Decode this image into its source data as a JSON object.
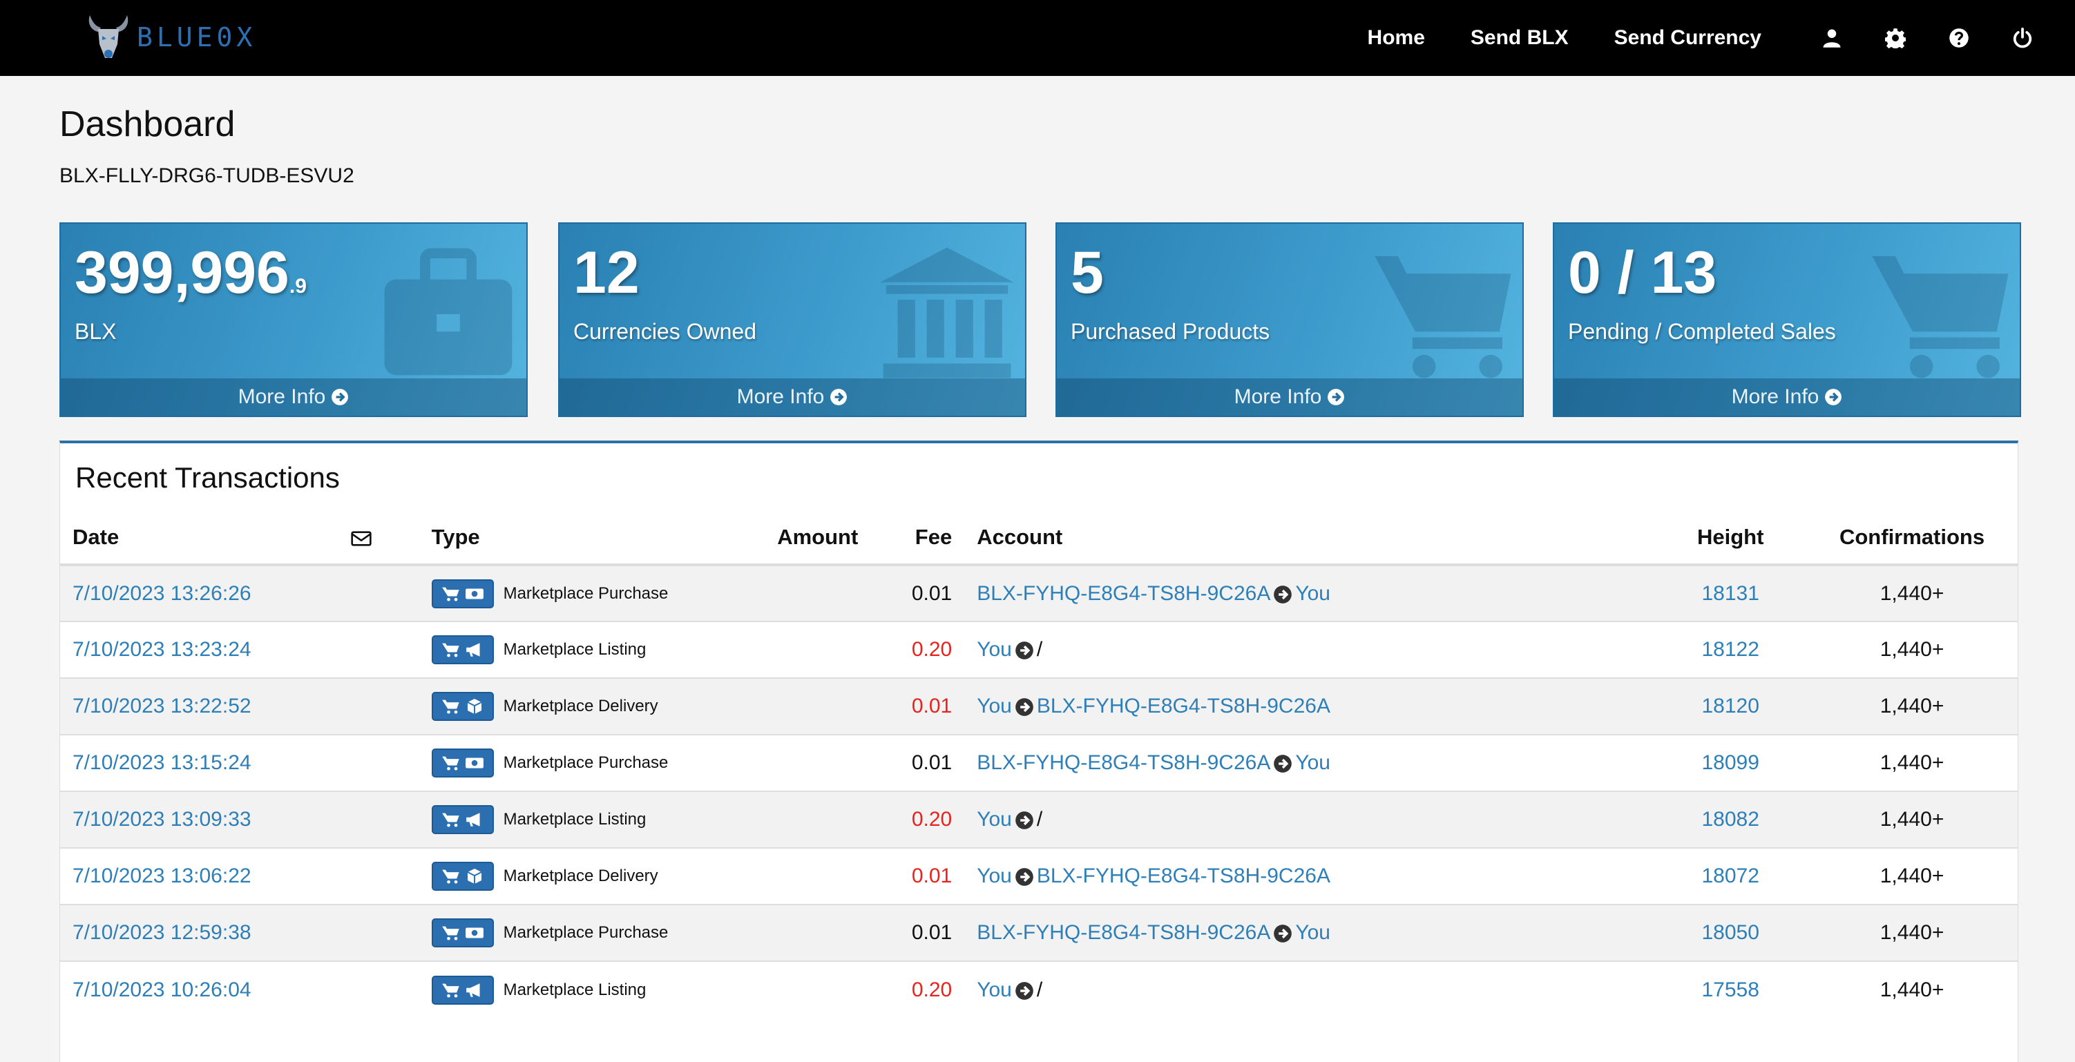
{
  "brand": {
    "name": "BLUE0X"
  },
  "nav": {
    "links": [
      "Home",
      "Send BLX",
      "Send Currency"
    ],
    "icons": [
      "user-icon",
      "gear-icon",
      "question-icon",
      "power-icon"
    ]
  },
  "page": {
    "title": "Dashboard",
    "account": "BLX-FLLY-DRG6-TUDB-ESVU2"
  },
  "info_boxes": [
    {
      "value": "399,996",
      "decimal": ".9",
      "label": "BLX",
      "footer": "More Info",
      "icon": "briefcase-icon"
    },
    {
      "value": "12",
      "decimal": "",
      "label": "Currencies Owned",
      "footer": "More Info",
      "icon": "bank-icon"
    },
    {
      "value": "5",
      "decimal": "",
      "label": "Purchased Products",
      "footer": "More Info",
      "icon": "cart-icon"
    },
    {
      "value": "0 / 13",
      "decimal": "",
      "label": "Pending / Completed Sales",
      "footer": "More Info",
      "icon": "cart-icon"
    }
  ],
  "transactions": {
    "title": "Recent Transactions",
    "columns": [
      "Date",
      "",
      "Type",
      "Amount",
      "Fee",
      "Account",
      "Height",
      "Confirmations"
    ],
    "rows": [
      {
        "date": "7/10/2023 13:26:26",
        "type": "Marketplace Purchase",
        "kind": "purchase",
        "amount": "",
        "fee": "0.01",
        "fee_color": "black",
        "from": "BLX-FYHQ-E8G4-TS8H-9C26A",
        "to": "You",
        "height": "18131",
        "confirmations": "1,440+"
      },
      {
        "date": "7/10/2023 13:23:24",
        "type": "Marketplace Listing",
        "kind": "listing",
        "amount": "",
        "fee": "0.20",
        "fee_color": "red",
        "from": "You",
        "to": "/",
        "height": "18122",
        "confirmations": "1,440+"
      },
      {
        "date": "7/10/2023 13:22:52",
        "type": "Marketplace Delivery",
        "kind": "delivery",
        "amount": "",
        "fee": "0.01",
        "fee_color": "red",
        "from": "You",
        "to": "BLX-FYHQ-E8G4-TS8H-9C26A",
        "height": "18120",
        "confirmations": "1,440+"
      },
      {
        "date": "7/10/2023 13:15:24",
        "type": "Marketplace Purchase",
        "kind": "purchase",
        "amount": "",
        "fee": "0.01",
        "fee_color": "black",
        "from": "BLX-FYHQ-E8G4-TS8H-9C26A",
        "to": "You",
        "height": "18099",
        "confirmations": "1,440+"
      },
      {
        "date": "7/10/2023 13:09:33",
        "type": "Marketplace Listing",
        "kind": "listing",
        "amount": "",
        "fee": "0.20",
        "fee_color": "red",
        "from": "You",
        "to": "/",
        "height": "18082",
        "confirmations": "1,440+"
      },
      {
        "date": "7/10/2023 13:06:22",
        "type": "Marketplace Delivery",
        "kind": "delivery",
        "amount": "",
        "fee": "0.01",
        "fee_color": "red",
        "from": "You",
        "to": "BLX-FYHQ-E8G4-TS8H-9C26A",
        "height": "18072",
        "confirmations": "1,440+"
      },
      {
        "date": "7/10/2023 12:59:38",
        "type": "Marketplace Purchase",
        "kind": "purchase",
        "amount": "",
        "fee": "0.01",
        "fee_color": "black",
        "from": "BLX-FYHQ-E8G4-TS8H-9C26A",
        "to": "You",
        "height": "18050",
        "confirmations": "1,440+"
      },
      {
        "date": "7/10/2023 10:26:04",
        "type": "Marketplace Listing",
        "kind": "listing",
        "amount": "",
        "fee": "0.20",
        "fee_color": "red",
        "from": "You",
        "to": "/",
        "height": "17558",
        "confirmations": "1,440+"
      }
    ]
  },
  "colors": {
    "accent": "#2e7fb8",
    "fee_red": "#e8231e",
    "box_blue": "#3d9bcc",
    "nav_bg": "#000000"
  }
}
